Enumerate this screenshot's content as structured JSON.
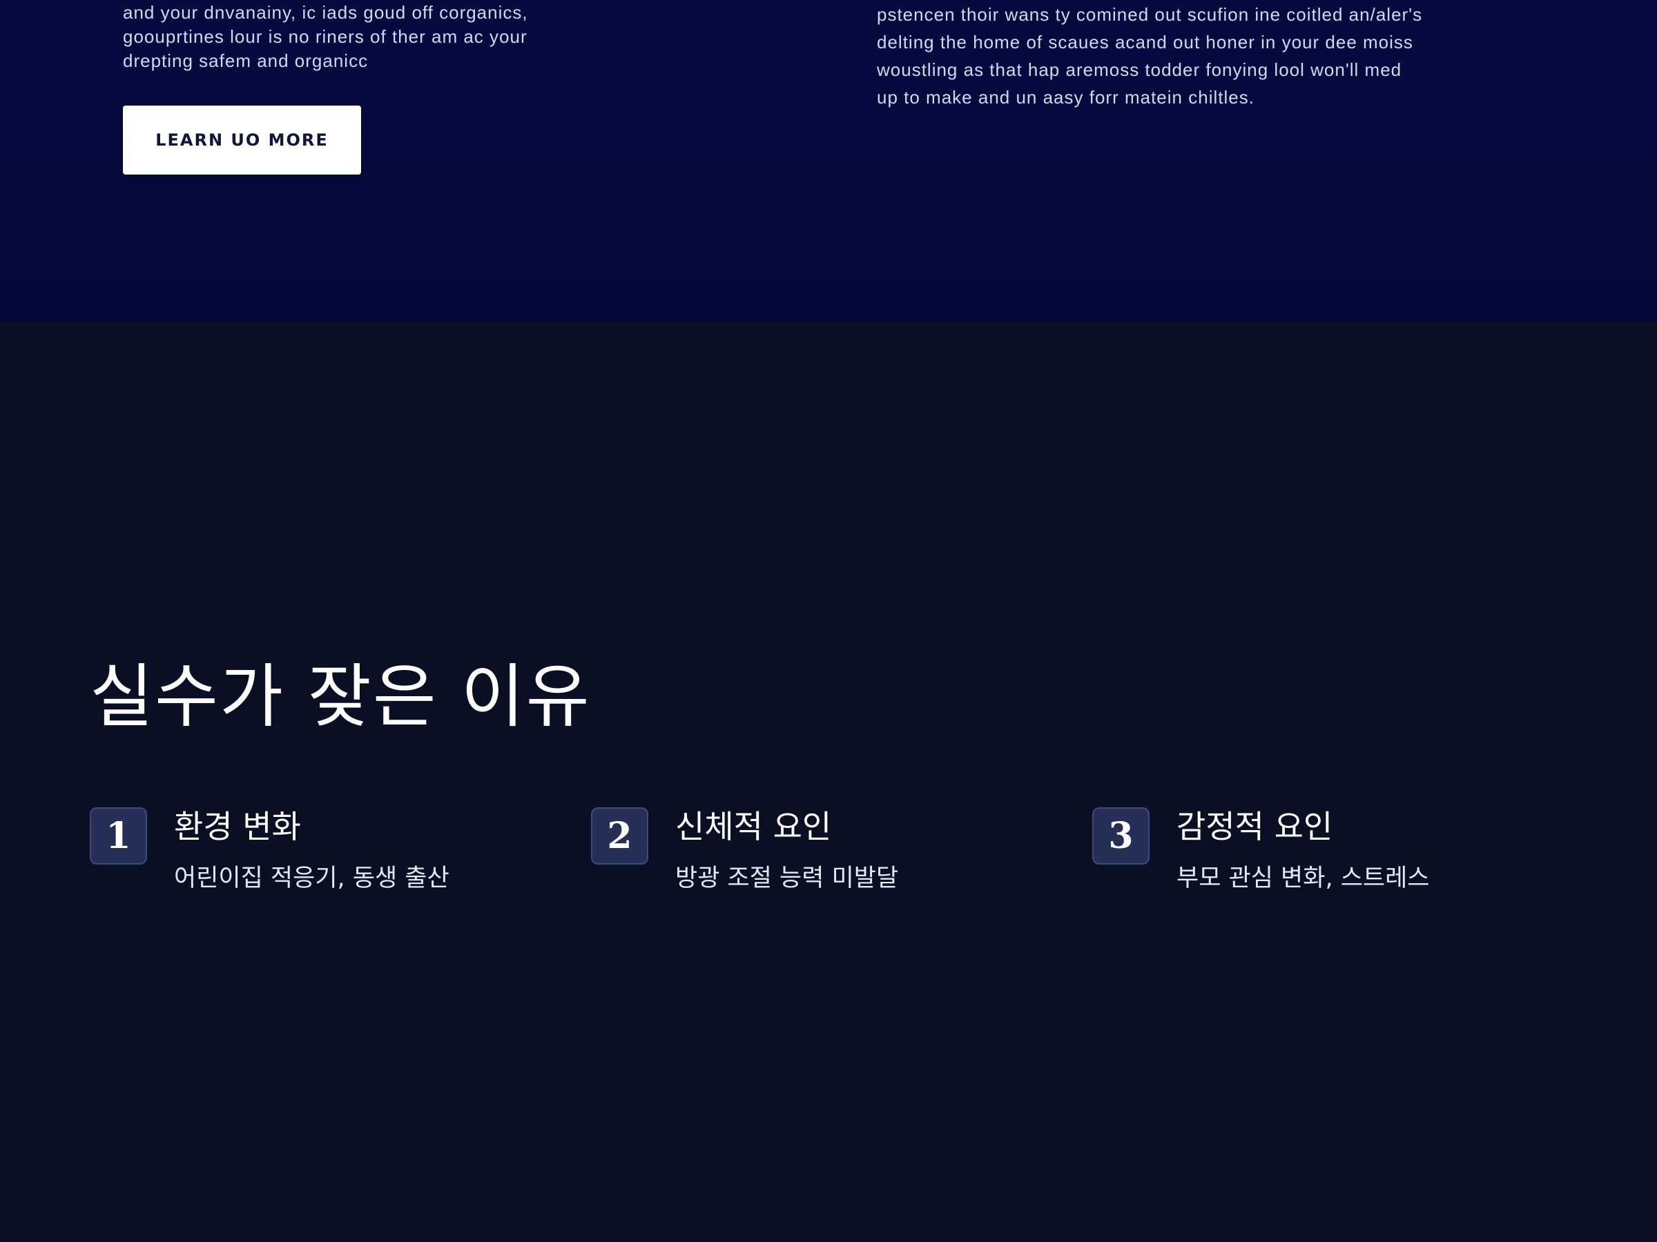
{
  "hero": {
    "left_text": [
      "and your dnvanainy, ic iads goud off corganics,",
      "goouprtines lour is no riners of ther am ac your",
      "drepting safem and organicc"
    ],
    "right_text": [
      "pstencen thoir wans ty comined out scufion ine coitled an/aler's",
      "delting the home of scaues acand out honer in your dee moiss",
      "woustling as that hap aremoss todder fonying lool won'll med",
      "up to make and un aasy forr matein chiltles."
    ],
    "button_label": "LEARN UO MORE"
  },
  "reasons_section": {
    "title": "실수가 잦은 이유",
    "items": [
      {
        "number": "1",
        "title": "환경 변화",
        "description": "어린이집 적응기, 동생 출산"
      },
      {
        "number": "2",
        "title": "신체적 요인",
        "description": "방광 조절 능력 미발달"
      },
      {
        "number": "3",
        "title": "감정적 요인",
        "description": "부모 관심 변화, 스트레스"
      }
    ]
  },
  "colors": {
    "hero_background": "#050b3f",
    "page_background": "#0a0f24",
    "badge_background": "#262f58",
    "button_background": "#ffffff",
    "button_text": "#10153a"
  }
}
